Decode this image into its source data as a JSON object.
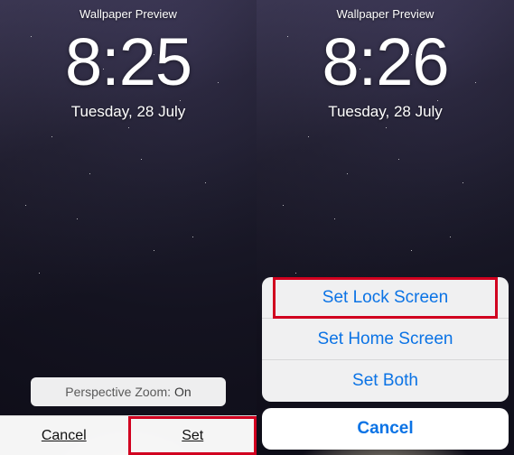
{
  "left": {
    "title": "Wallpaper Preview",
    "time": "8:25",
    "date": "Tuesday, 28 July",
    "perspective_label": "Perspective Zoom:",
    "perspective_value": "On",
    "cancel_label": "Cancel",
    "set_label": "Set"
  },
  "right": {
    "title": "Wallpaper Preview",
    "time": "8:26",
    "date": "Tuesday, 28 July",
    "actions": {
      "set_lock": "Set Lock Screen",
      "set_home": "Set Home Screen",
      "set_both": "Set Both",
      "cancel": "Cancel"
    }
  }
}
